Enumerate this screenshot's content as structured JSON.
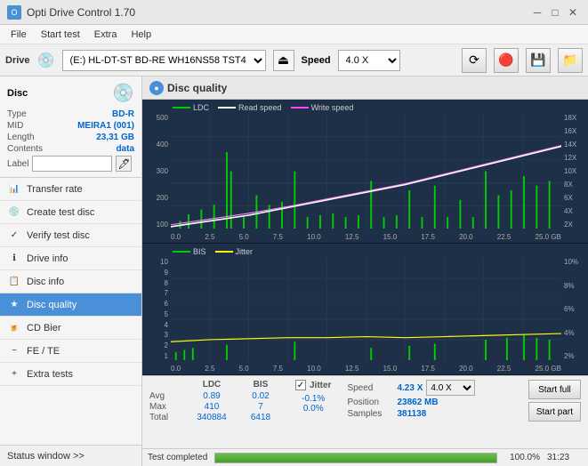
{
  "titlebar": {
    "title": "Opti Drive Control 1.70",
    "minimize": "─",
    "maximize": "□",
    "close": "✕"
  },
  "menubar": {
    "items": [
      "File",
      "Start test",
      "Extra",
      "Help"
    ]
  },
  "drivebar": {
    "label": "Drive",
    "drive_value": "(E:) HL-DT-ST BD-RE  WH16NS58 TST4",
    "speed_label": "Speed",
    "speed_value": "4.0 X"
  },
  "disc": {
    "title": "Disc",
    "type_label": "Type",
    "type_value": "BD-R",
    "mid_label": "MID",
    "mid_value": "MEIRA1 (001)",
    "length_label": "Length",
    "length_value": "23,31 GB",
    "contents_label": "Contents",
    "contents_value": "data",
    "label_label": "Label"
  },
  "sidebar": {
    "items": [
      {
        "id": "transfer-rate",
        "label": "Transfer rate",
        "icon": "📊"
      },
      {
        "id": "create-test-disc",
        "label": "Create test disc",
        "icon": "💿"
      },
      {
        "id": "verify-test-disc",
        "label": "Verify test disc",
        "icon": "✓"
      },
      {
        "id": "drive-info",
        "label": "Drive info",
        "icon": "ℹ"
      },
      {
        "id": "disc-info",
        "label": "Disc info",
        "icon": "📋"
      },
      {
        "id": "disc-quality",
        "label": "Disc quality",
        "icon": "★",
        "active": true
      },
      {
        "id": "cd-bier",
        "label": "CD Bier",
        "icon": "🍺"
      },
      {
        "id": "fe-te",
        "label": "FE / TE",
        "icon": "~"
      },
      {
        "id": "extra-tests",
        "label": "Extra tests",
        "icon": "+"
      }
    ]
  },
  "status_window": {
    "label": "Status window >>",
    "status": "Test completed"
  },
  "disc_quality": {
    "title": "Disc quality",
    "legend": {
      "ldc": "LDC",
      "read_speed": "Read speed",
      "write_speed": "Write speed",
      "bis": "BIS",
      "jitter": "Jitter"
    }
  },
  "chart1": {
    "yaxis_left": [
      "500",
      "400",
      "300",
      "200",
      "100"
    ],
    "yaxis_right": [
      "18X",
      "16X",
      "14X",
      "12X",
      "10X",
      "8X",
      "6X",
      "4X",
      "2X"
    ],
    "xaxis": [
      "0.0",
      "2.5",
      "5.0",
      "7.5",
      "10.0",
      "12.5",
      "15.0",
      "17.5",
      "20.0",
      "22.5",
      "25.0 GB"
    ]
  },
  "chart2": {
    "yaxis_left": [
      "10",
      "9",
      "8",
      "7",
      "6",
      "5",
      "4",
      "3",
      "2",
      "1"
    ],
    "yaxis_right": [
      "10%",
      "8%",
      "6%",
      "4%",
      "2%"
    ],
    "xaxis": [
      "0.0",
      "2.5",
      "5.0",
      "7.5",
      "10.0",
      "12.5",
      "15.0",
      "17.5",
      "20.0",
      "22.5",
      "25.0 GB"
    ]
  },
  "stats": {
    "headers": [
      "",
      "LDC",
      "BIS",
      "",
      "Jitter",
      "Speed"
    ],
    "avg": {
      "label": "Avg",
      "ldc": "0.89",
      "bis": "0.02",
      "jitter": "-0.1%"
    },
    "max": {
      "label": "Max",
      "ldc": "410",
      "bis": "7",
      "jitter": "0.0%"
    },
    "total": {
      "label": "Total",
      "ldc": "340884",
      "bis": "6418"
    },
    "speed_label": "Speed",
    "speed_value": "4.23 X",
    "speed_select": "4.0 X",
    "position_label": "Position",
    "position_value": "23862 MB",
    "samples_label": "Samples",
    "samples_value": "381138",
    "jitter_checked": true,
    "btn_start_full": "Start full",
    "btn_start_part": "Start part"
  },
  "progress": {
    "status": "Test completed",
    "percent": "100.0%",
    "fill_width": "100",
    "time": "31:23"
  },
  "colors": {
    "ldc_color": "#00aa00",
    "read_speed_color": "#ffffff",
    "write_speed_color": "#ff44ff",
    "bis_color": "#00aa00",
    "jitter_color": "#ffff00",
    "chart_bg": "#1e3048",
    "grid_line": "#2a4060",
    "accent_blue": "#4a90d9"
  }
}
